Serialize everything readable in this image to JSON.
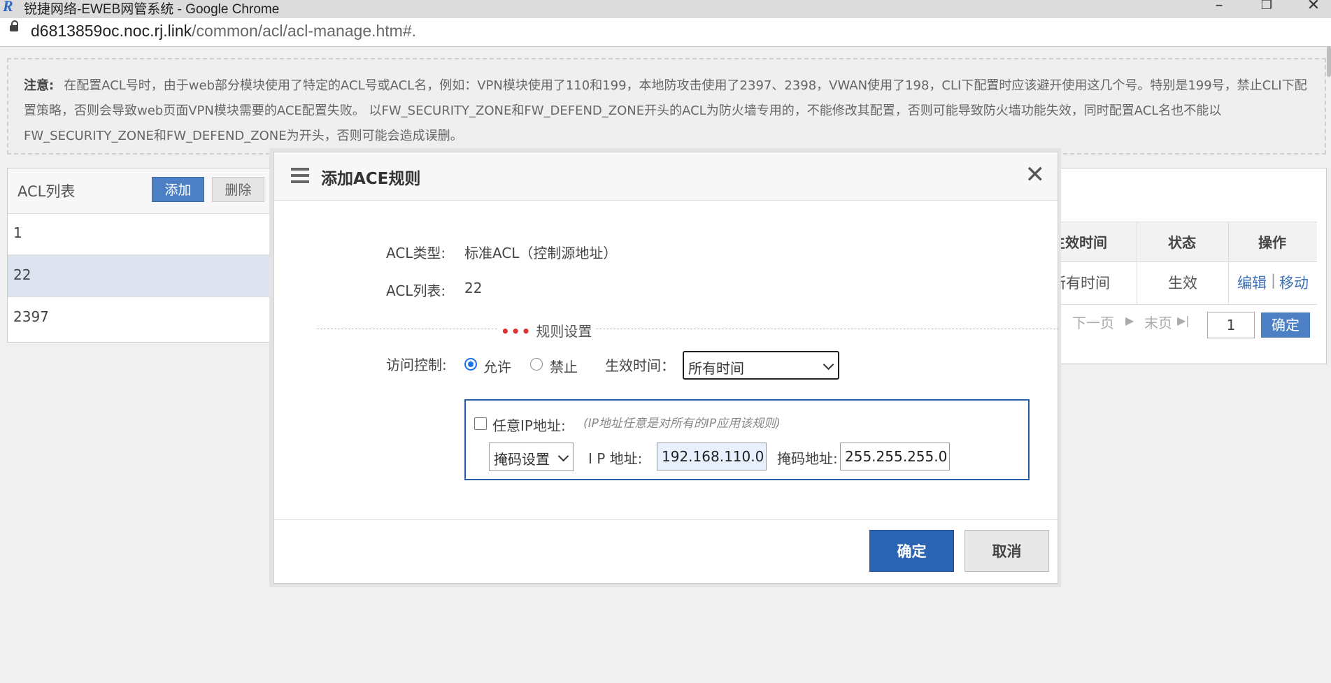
{
  "window": {
    "title": "锐捷网络-EWEB网管系统 - Google Chrome",
    "logo": "R"
  },
  "address": {
    "host": "d6813859oc.noc.rj.link",
    "path": "/common/acl/acl-manage.htm#."
  },
  "notice": {
    "label": "注意:",
    "text": "在配置ACL号时，由于web部分模块使用了特定的ACL号或ACL名，例如：VPN模块使用了110和199，本地防攻击使用了2397、2398，VWAN使用了198，CLI下配置时应该避开使用这几个号。特别是199号，禁止CLI下配置策略，否则会导致web页面VPN模块需要的ACE配置失败。 以FW_SECURITY_ZONE和FW_DEFEND_ZONE开头的ACL为防火墙专用的，不能修改其配置，否则可能导致防火墙功能失效，同时配置ACL名也不能以FW_SECURITY_ZONE和FW_DEFEND_ZONE为开头，否则可能会造成误删。"
  },
  "acl_list": {
    "title": "ACL列表",
    "add_label": "添加",
    "delete_label": "删除",
    "items": [
      "1",
      "22",
      "2397"
    ],
    "selected": "22"
  },
  "rule_table": {
    "headers": [
      "生效时间",
      "状态",
      "操作"
    ],
    "row": {
      "time": "所有时间",
      "status": "生效",
      "edit": "编辑",
      "sep": "|",
      "move": "移动"
    },
    "pager": {
      "next": "下一页",
      "last": "末页",
      "page": "1",
      "ok": "确定"
    }
  },
  "modal": {
    "title": "添加ACE规则",
    "acl_type_label": "ACL类型:",
    "acl_type_value": "标准ACL（控制源地址）",
    "acl_list_label": "ACL列表:",
    "acl_list_value": "22",
    "section_label": "规则设置",
    "access_label": "访问控制:",
    "allow_label": "允许",
    "deny_label": "禁止",
    "access_selected": "允许",
    "time_label": "生效时间：",
    "time_value": "所有时间",
    "any_ip_label": "任意IP地址:",
    "any_ip_hint": "(IP地址任意是对所有的IP应用该规则)",
    "any_ip_checked": false,
    "mask_mode": "掩码设置",
    "ip_label": "I P 地址:",
    "ip_value": "192.168.110.0",
    "mask_label": "掩码地址:",
    "mask_value": "255.255.255.0",
    "ok_label": "确定",
    "cancel_label": "取消"
  }
}
